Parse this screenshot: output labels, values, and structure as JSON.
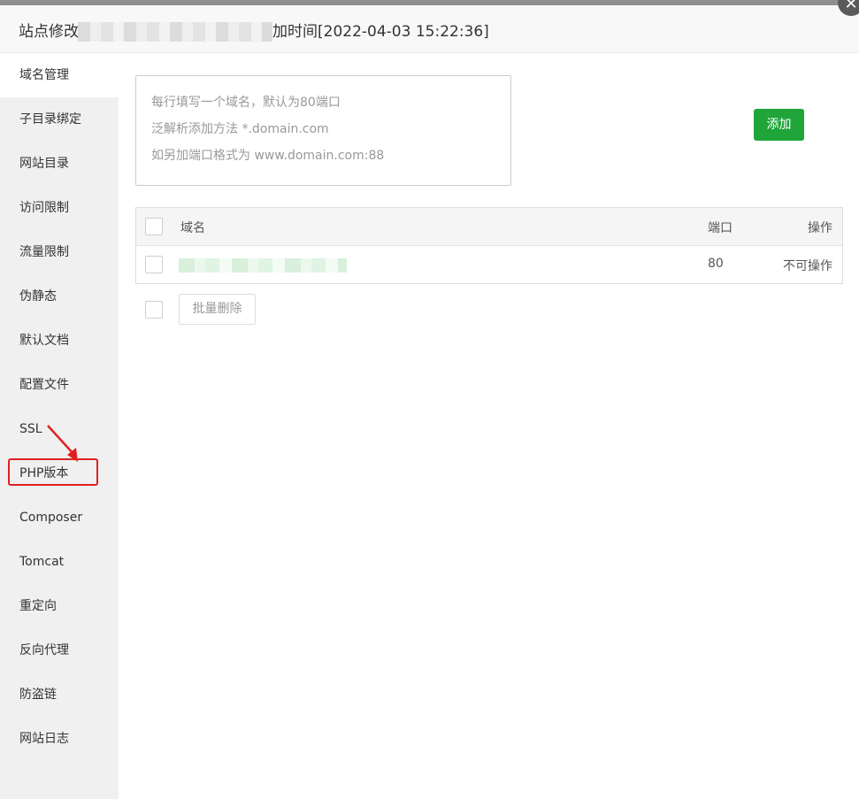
{
  "window": {
    "title_prefix": "站点修改",
    "title_suffix": "加时间[2022-04-03 15:22:36]",
    "close_glyph": "✕"
  },
  "sidebar": {
    "items": [
      {
        "label": "域名管理",
        "name": "domain-management"
      },
      {
        "label": "子目录绑定",
        "name": "subdirectory-binding"
      },
      {
        "label": "网站目录",
        "name": "site-directory"
      },
      {
        "label": "访问限制",
        "name": "access-restriction"
      },
      {
        "label": "流量限制",
        "name": "traffic-limit"
      },
      {
        "label": "伪静态",
        "name": "rewrite"
      },
      {
        "label": "默认文档",
        "name": "default-document"
      },
      {
        "label": "配置文件",
        "name": "config-file"
      },
      {
        "label": "SSL",
        "name": "ssl"
      },
      {
        "label": "PHP版本",
        "name": "php-version"
      },
      {
        "label": "Composer",
        "name": "composer"
      },
      {
        "label": "Tomcat",
        "name": "tomcat"
      },
      {
        "label": "重定向",
        "name": "redirect"
      },
      {
        "label": "反向代理",
        "name": "reverse-proxy"
      },
      {
        "label": "防盗链",
        "name": "hotlink-protection"
      },
      {
        "label": "网站日志",
        "name": "site-log"
      }
    ]
  },
  "domain_input": {
    "hints": [
      "每行填写一个域名，默认为80端口",
      "泛解析添加方法 *.domain.com",
      "如另加端口格式为 www.domain.com:88"
    ]
  },
  "add_button": "添加",
  "table": {
    "headers": {
      "domain": "域名",
      "port": "端口",
      "action": "操作"
    },
    "rows": [
      {
        "domain": "",
        "port": "80",
        "action": "不可操作"
      }
    ]
  },
  "batch_delete": "批量删除",
  "colors": {
    "accent_green": "#20a53a",
    "annotation_red": "#e02020"
  }
}
